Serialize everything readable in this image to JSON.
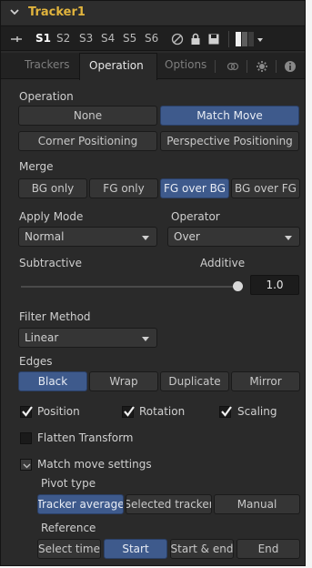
{
  "title": "Tracker1",
  "toolbar": {
    "slots": [
      "S1",
      "S2",
      "S3",
      "S4",
      "S5",
      "S6"
    ],
    "active_slot": "S1"
  },
  "tabs": [
    "Trackers",
    "Operation",
    "Options"
  ],
  "active_tab": "Operation",
  "operation": {
    "label": "Operation",
    "buttons": [
      "None",
      "Match Move",
      "Corner Positioning",
      "Perspective Positioning"
    ],
    "selected": "Match Move"
  },
  "merge": {
    "label": "Merge",
    "buttons": [
      "BG only",
      "FG only",
      "FG over BG",
      "BG over FG"
    ],
    "selected": "FG over BG"
  },
  "apply_mode": {
    "label": "Apply Mode",
    "value": "Normal"
  },
  "operator": {
    "label": "Operator",
    "value": "Over"
  },
  "blend": {
    "left_label": "Subtractive",
    "right_label": "Additive",
    "value": "1.0",
    "fraction": 1.0
  },
  "filter_method": {
    "label": "Filter Method",
    "value": "Linear"
  },
  "edges": {
    "label": "Edges",
    "buttons": [
      "Black",
      "Wrap",
      "Duplicate",
      "Mirror"
    ],
    "selected": "Black"
  },
  "checks": {
    "position": {
      "label": "Position",
      "checked": true
    },
    "rotation": {
      "label": "Rotation",
      "checked": true
    },
    "scaling": {
      "label": "Scaling",
      "checked": true
    },
    "flatten": {
      "label": "Flatten Transform",
      "checked": false
    },
    "match_move_settings": {
      "label": "Match move settings",
      "checked": false
    }
  },
  "pivot_type": {
    "label": "Pivot type",
    "buttons": [
      "Tracker average",
      "Selected tracker",
      "Manual"
    ],
    "selected": "Tracker average"
  },
  "reference": {
    "label": "Reference",
    "buttons": [
      "Select time",
      "Start",
      "Start & end",
      "End"
    ],
    "selected": "Start"
  },
  "icons": [
    "chevron-down-icon",
    "pin-icon",
    "no-entry-icon",
    "lock-icon",
    "save-icon",
    "color-swatch-icon",
    "caret-down-icon",
    "chain-icon",
    "gear-icon",
    "info-icon"
  ],
  "colors": {
    "title": "#e1b43d",
    "selected_button": "#3e5a8c",
    "panel_bg": "#2a2a2a"
  }
}
